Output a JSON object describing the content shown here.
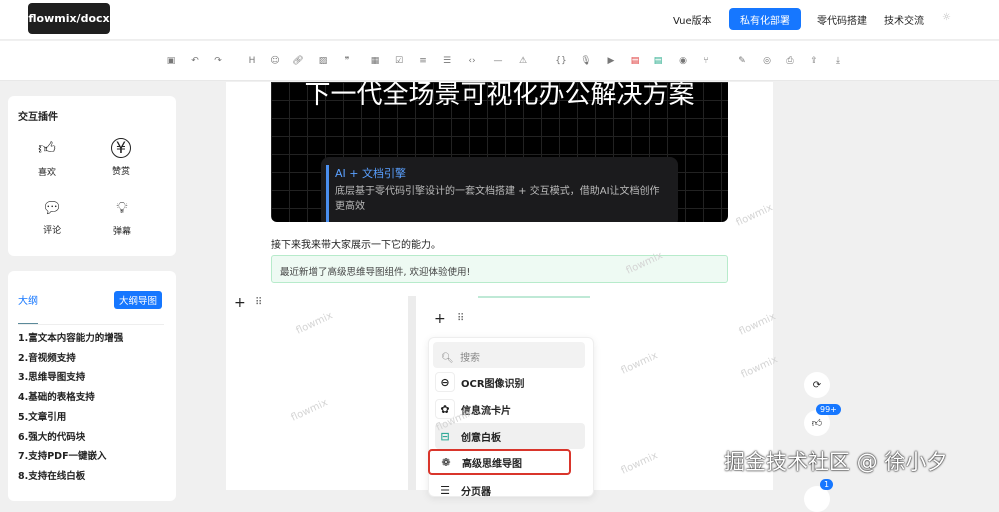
{
  "header": {
    "logo": "flowmix/docx",
    "nav": [
      "Vue版本",
      "私有化部署",
      "零代码搭建",
      "技术交流"
    ]
  },
  "toolbar": {
    "icons": [
      "save-icon",
      "undo-icon",
      "redo-icon",
      "heading-icon",
      "emoji-icon",
      "link-icon",
      "image-icon",
      "quote-icon",
      "table-icon",
      "checkbox-icon",
      "ordered-list-icon",
      "bullet-list-icon",
      "code-icon",
      "divider-icon",
      "alert-icon",
      "code-block-icon",
      "audio-icon",
      "video-icon",
      "pdf-icon",
      "excel-icon",
      "mindmap-icon",
      "branch-icon",
      "brush-icon",
      "preview-icon",
      "print-icon",
      "export-icon",
      "import-icon"
    ]
  },
  "plugins": {
    "title": "交互插件",
    "items": [
      "喜欢",
      "赞赏",
      "评论",
      "弹幕"
    ]
  },
  "outline": {
    "tab": "大纲",
    "button": "大纲导图",
    "items": [
      "1.富文本内容能力的增强",
      "2.音视频支持",
      "3.思维导图支持",
      "4.基础的表格支持",
      "5.文章引用",
      "6.强大的代码块",
      "7.支持PDF一键嵌入",
      "8.支持在线白板"
    ]
  },
  "doc": {
    "banner_title": "下一代全场景可视化办公解决方案",
    "ai_title": "AI + 文档引擎",
    "ai_desc": "底层基于零代码引擎设计的一套文档搭建 + 交互模式，借助AI让文档创作更高效",
    "paragraph": "接下来我来带大家展示一下它的能力。",
    "tip": "最近新增了高级思维导图组件, 欢迎体验使用!"
  },
  "menu": {
    "search_placeholder": "搜索",
    "items": [
      "OCR图像识别",
      "信息流卡片",
      "创意白板",
      "高级思维导图",
      "分页器"
    ]
  },
  "float": {
    "like_count": "99+",
    "comment_count": "1"
  },
  "watermark": "flowmix",
  "credit": "掘金技术社区 @ 徐小夕",
  "colors": {
    "accent": "#1677ff",
    "highlight_border": "#d9352b"
  }
}
